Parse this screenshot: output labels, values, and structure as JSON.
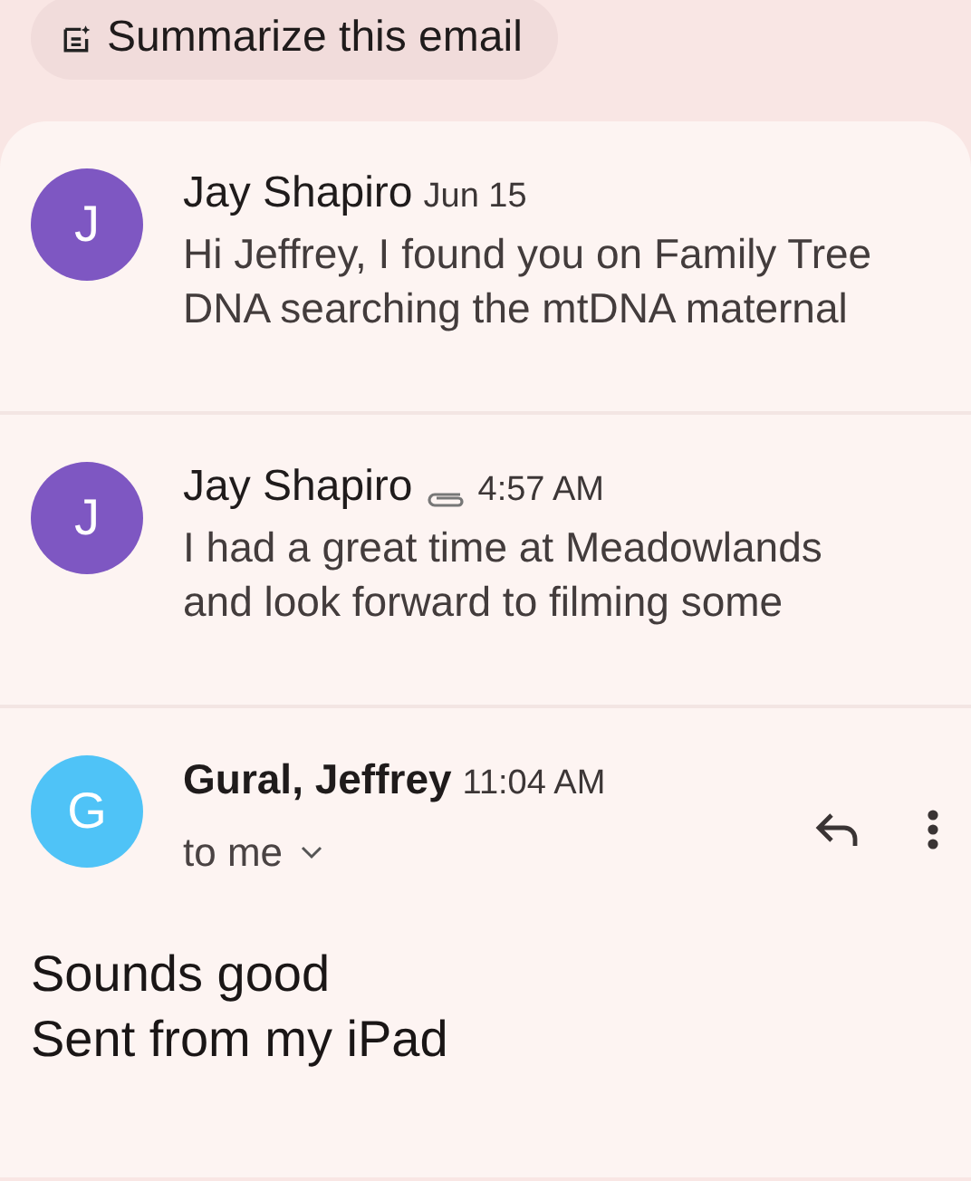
{
  "summarize_button": {
    "label": "Summarize this email"
  },
  "messages": [
    {
      "kind": "collapsed",
      "avatar_letter": "J",
      "color": "#7e57c2",
      "sender": "Jay Shapiro",
      "has_attachment": false,
      "time": "Jun 15",
      "snippet": "Hi Jeffrey, I found you on Family Tree DNA searching the mtDNA maternal"
    },
    {
      "kind": "collapsed",
      "avatar_letter": "J",
      "color": "#7e57c2",
      "sender": "Jay Shapiro",
      "has_attachment": true,
      "time": "4:57 AM",
      "snippet": "I had a great time at Meadowlands and look forward to filming some"
    },
    {
      "kind": "expanded",
      "avatar_letter": "G",
      "color": "#4fc3f7",
      "sender": "Gural, Jeffrey",
      "time": "11:04 AM",
      "recipient": "to me",
      "body": [
        "Sounds good",
        "Sent from my iPad"
      ]
    }
  ]
}
